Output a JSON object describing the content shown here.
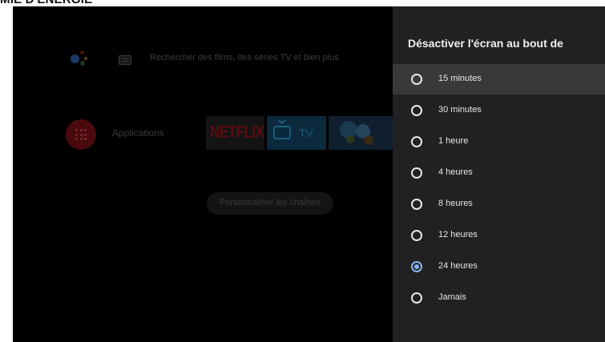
{
  "page": {
    "heading": "MIE D'ÉNERGIE"
  },
  "home": {
    "search_hint": "Rechercher des films, des séries TV et bien plus",
    "apps_label": "Applications",
    "channels": {
      "netflix_label": "NETFLIX",
      "tv_label": "TV"
    },
    "customize_label": "Personnaliser les chaînes"
  },
  "panel": {
    "title": "Désactiver l'écran au bout de",
    "options": [
      {
        "label": "15 minutes",
        "selected": false,
        "focused": true
      },
      {
        "label": "30 minutes",
        "selected": false,
        "focused": false
      },
      {
        "label": "1 heure",
        "selected": false,
        "focused": false
      },
      {
        "label": "4 heures",
        "selected": false,
        "focused": false
      },
      {
        "label": "8 heures",
        "selected": false,
        "focused": false
      },
      {
        "label": "12 heures",
        "selected": false,
        "focused": false
      },
      {
        "label": "24 heures",
        "selected": true,
        "focused": false
      },
      {
        "label": "Jamais",
        "selected": false,
        "focused": false
      }
    ]
  },
  "colors": {
    "panel_background": "#212121",
    "focus_highlight": "#393939",
    "radio_selected": "#8ab4f8",
    "screen_background": "#000000"
  }
}
